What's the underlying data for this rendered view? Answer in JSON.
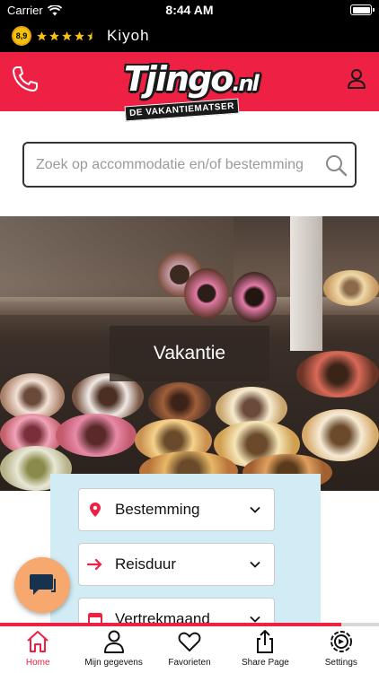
{
  "status_bar": {
    "carrier": "Carrier",
    "time": "8:44 AM"
  },
  "kiyoh": {
    "score": "8,9",
    "label": "Kiyoh",
    "star_count": 4.5
  },
  "header": {
    "logo_text": "Tjingo",
    "logo_suffix": ".nl",
    "logo_tagline": "DE VAKANTIEMATSER",
    "brand_color": "#ee2145"
  },
  "search": {
    "placeholder": "Zoek op accommodatie en/of bestemming",
    "value": ""
  },
  "hero": {
    "caption": "Vakantie"
  },
  "filters": [
    {
      "label": "Bestemming",
      "icon": "location-pin-icon"
    },
    {
      "label": "Reisduur",
      "icon": "arrow-right-icon"
    },
    {
      "label": "Vertrekmaand",
      "icon": "calendar-icon"
    }
  ],
  "tabs": [
    {
      "label": "Home",
      "icon": "home-icon",
      "active": true
    },
    {
      "label": "Mijn gegevens",
      "icon": "person-icon",
      "active": false
    },
    {
      "label": "Favorieten",
      "icon": "heart-icon",
      "active": false
    },
    {
      "label": "Share Page",
      "icon": "share-icon",
      "active": false
    },
    {
      "label": "Settings",
      "icon": "settings-icon",
      "active": false
    }
  ]
}
